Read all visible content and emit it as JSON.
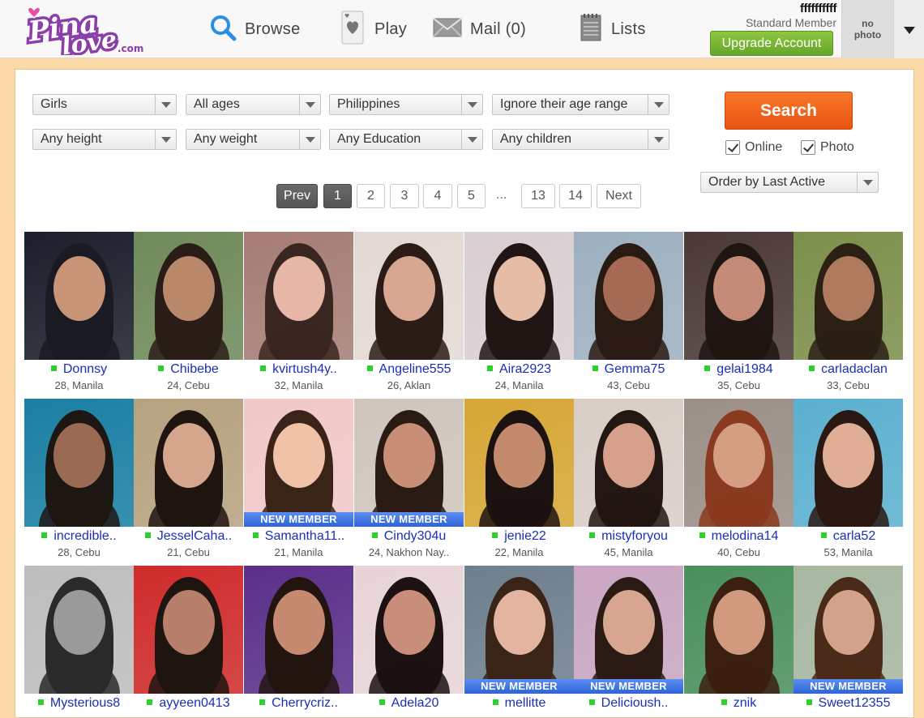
{
  "header": {
    "logo_text": "Pina",
    "logo_text2": "love",
    "logo_domain": ".com",
    "nav": {
      "browse": "Browse",
      "play": "Play",
      "mail": "Mail (0)",
      "lists": "Lists"
    },
    "username": "ffffffffff",
    "member_level": "Standard Member",
    "upgrade_label": "Upgrade Account",
    "avatar_line1": "no",
    "avatar_line2": "photo"
  },
  "filters": {
    "gender": "Girls",
    "age": "All ages",
    "country": "Philippines",
    "age_range": "Ignore their age range",
    "height": "Any height",
    "weight": "Any weight",
    "education": "Any Education",
    "children": "Any children",
    "search_label": "Search",
    "online_label": "Online",
    "photo_label": "Photo",
    "order": "Order by Last Active"
  },
  "pagination": {
    "prev": "Prev",
    "pages": [
      "1",
      "2",
      "3",
      "4",
      "5"
    ],
    "ellipsis": "...",
    "last_pages": [
      "13",
      "14"
    ],
    "next": "Next"
  },
  "profiles": [
    {
      "name": "Donnsy",
      "meta": "28, Manila",
      "new": ""
    },
    {
      "name": "Chibebe",
      "meta": "24, Cebu",
      "new": ""
    },
    {
      "name": "kvirtush4y..",
      "meta": "32, Manila",
      "new": ""
    },
    {
      "name": "Angeline555",
      "meta": "26, Aklan",
      "new": ""
    },
    {
      "name": "Aira2923",
      "meta": "24, Manila",
      "new": ""
    },
    {
      "name": "Gemma75",
      "meta": "43, Cebu",
      "new": ""
    },
    {
      "name": "gelai1984",
      "meta": "35, Cebu",
      "new": ""
    },
    {
      "name": "carladaclan",
      "meta": "33, Cebu",
      "new": ""
    },
    {
      "name": "incredible..",
      "meta": "28, Cebu",
      "new": ""
    },
    {
      "name": "JesselCaha..",
      "meta": "21, Cebu",
      "new": ""
    },
    {
      "name": "Samantha11..",
      "meta": "21, Manila",
      "new": "NEW MEMBER"
    },
    {
      "name": "Cindy304u",
      "meta": "24, Nakhon Nay..",
      "new": "NEW MEMBER"
    },
    {
      "name": "jenie22",
      "meta": "22, Manila",
      "new": ""
    },
    {
      "name": "mistyforyou",
      "meta": "45, Manila",
      "new": ""
    },
    {
      "name": "melodina14",
      "meta": "40, Cebu",
      "new": ""
    },
    {
      "name": "carla52",
      "meta": "53, Manila",
      "new": ""
    },
    {
      "name": "Mysterious8",
      "meta": "",
      "new": ""
    },
    {
      "name": "ayyeen0413",
      "meta": "",
      "new": ""
    },
    {
      "name": "Cherrycriz..",
      "meta": "",
      "new": ""
    },
    {
      "name": "Adela20",
      "meta": "",
      "new": ""
    },
    {
      "name": "mellitte",
      "meta": "",
      "new": "NEW MEMBER"
    },
    {
      "name": "Delicioush..",
      "meta": "",
      "new": "NEW MEMBER"
    },
    {
      "name": "znik",
      "meta": "",
      "new": ""
    },
    {
      "name": "Sweet12355",
      "meta": "",
      "new": "NEW MEMBER"
    }
  ],
  "colors": {
    "accent_orange": "#f06a1c",
    "upgrade_green": "#7bb836",
    "link_blue": "#1a2fb8",
    "online_green": "#2ed02e",
    "new_badge_blue": "#3b6fe0",
    "logo_purple": "#8b3fa8"
  }
}
